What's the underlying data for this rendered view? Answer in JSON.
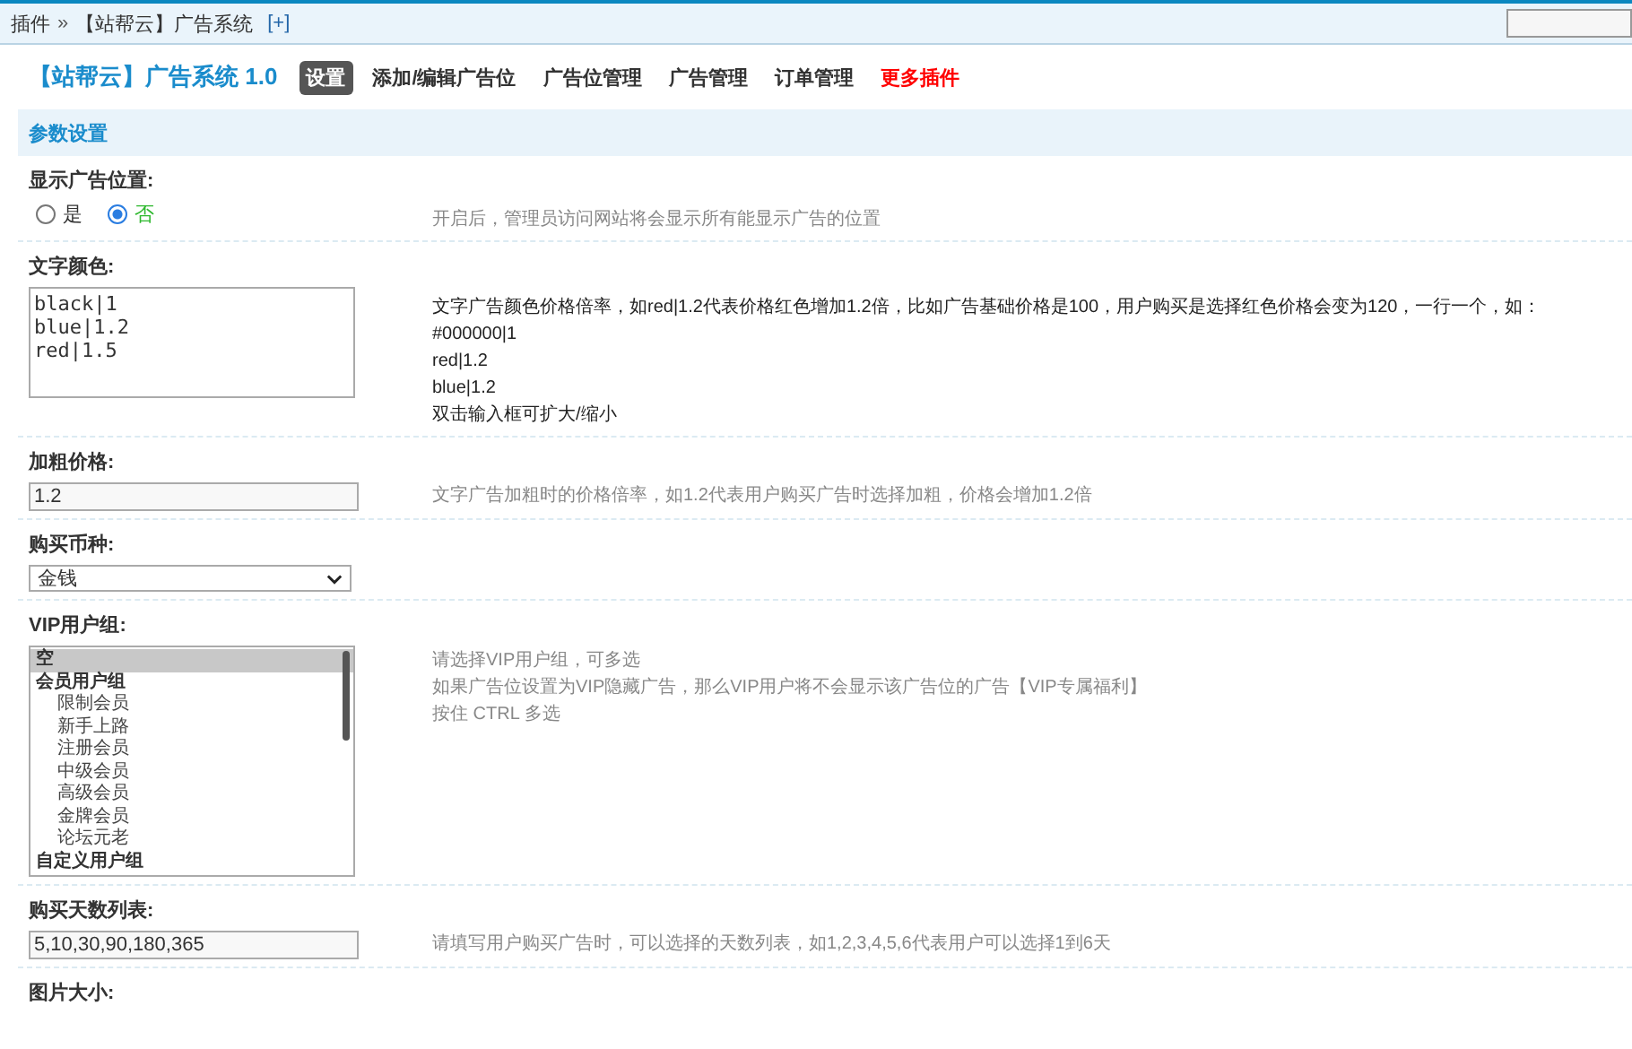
{
  "breadcrumb": {
    "parent": "插件",
    "separator": "»",
    "current": "【站帮云】广告系统",
    "add_link": "[+]"
  },
  "header": {
    "title": "【站帮云】广告系统 1.0",
    "tabs": [
      {
        "label": "设置",
        "selected": true
      },
      {
        "label": "添加/编辑广告位",
        "selected": false
      },
      {
        "label": "广告位管理",
        "selected": false
      },
      {
        "label": "广告管理",
        "selected": false
      },
      {
        "label": "订单管理",
        "selected": false
      },
      {
        "label": "更多插件",
        "selected": false,
        "color": "#ff0000"
      }
    ]
  },
  "section_title": "参数设置",
  "settings": [
    {
      "kind": "radio",
      "label": "显示广告位置:",
      "options": [
        {
          "label": "是",
          "selected": false
        },
        {
          "label": "否",
          "selected": true
        }
      ],
      "tips": [
        "开启后，管理员访问网站将会显示所有能显示广告的位置"
      ]
    },
    {
      "kind": "textarea",
      "label": "文字颜色:",
      "value": "black|1\nblue|1.2\nred|1.5",
      "tips": [
        "文字广告颜色价格倍率，如red|1.2代表价格红色增加1.2倍，比如广告基础价格是100，用户购买是选择红色价格会变为120，一行一个，如：",
        "#000000|1",
        "red|1.2",
        "blue|1.2",
        "双击输入框可扩大/缩小"
      ]
    },
    {
      "kind": "text",
      "label": "加粗价格:",
      "value": "1.2",
      "tips": [
        "文字广告加粗时的价格倍率，如1.2代表用户购买广告时选择加粗，价格会增加1.2倍"
      ]
    },
    {
      "kind": "select",
      "label": "购买币种:",
      "value": "金钱"
    },
    {
      "kind": "multiselect",
      "label": "VIP用户组:",
      "options": [
        {
          "label": "空",
          "selected": true
        },
        {
          "label": "会员用户组",
          "selected": false,
          "children": [
            {
              "label": "限制会员",
              "selected": false
            },
            {
              "label": "新手上路",
              "selected": false
            },
            {
              "label": "注册会员",
              "selected": false
            },
            {
              "label": "中级会员",
              "selected": false
            },
            {
              "label": "高级会员",
              "selected": false
            },
            {
              "label": "金牌会员",
              "selected": false
            },
            {
              "label": "论坛元老",
              "selected": false
            }
          ]
        },
        {
          "label": "自定义用户组",
          "selected": false
        }
      ],
      "tips": [
        "请选择VIP用户组，可多选",
        "如果广告位设置为VIP隐藏广告，那么VIP用户将不会显示该广告位的广告【VIP专属福利】",
        "按住 CTRL 多选"
      ]
    },
    {
      "kind": "text",
      "label": "购买天数列表:",
      "value": "5,10,30,90,180,365",
      "tips": [
        "请填写用户购买广告时，可以选择的天数列表，如1,2,3,4,5,6代表用户可以选择1到6天"
      ]
    },
    {
      "kind": "none",
      "label": "图片大小:"
    }
  ]
}
